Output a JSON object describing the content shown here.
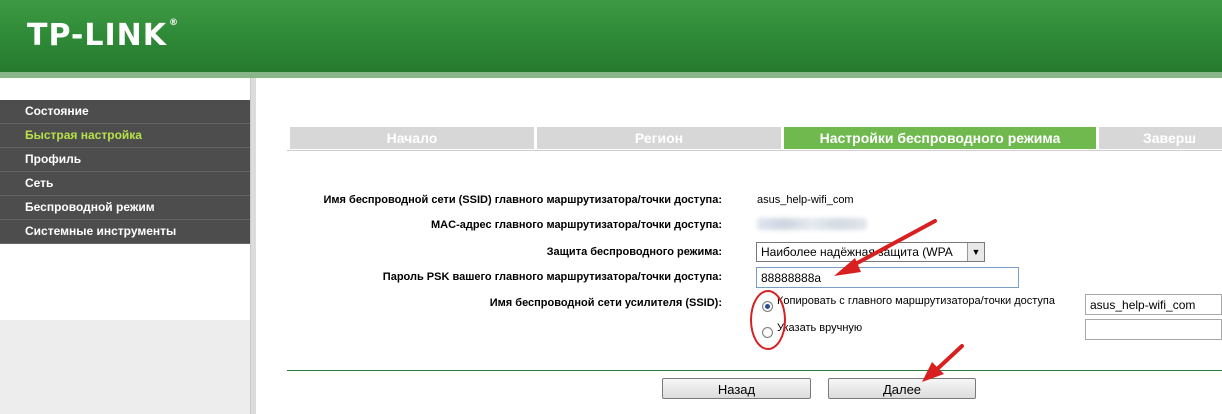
{
  "header": {
    "logo": "TP-LINK",
    "logo_mark": "®"
  },
  "sidebar": {
    "items": [
      {
        "label": "Состояние",
        "active": false
      },
      {
        "label": "Быстрая настройка",
        "active": true
      },
      {
        "label": "Профиль",
        "active": false
      },
      {
        "label": "Сеть",
        "active": false
      },
      {
        "label": "Беспроводной режим",
        "active": false
      },
      {
        "label": "Системные инструменты",
        "active": false
      }
    ]
  },
  "steps": [
    {
      "label": "Начало",
      "active": false
    },
    {
      "label": "Регион",
      "active": false
    },
    {
      "label": "Настройки беспроводного режима",
      "active": true
    },
    {
      "label": "Заверш",
      "active": false
    }
  ],
  "form": {
    "ssid_label": "Имя беспроводной сети (SSID) главного маршрутизатора/точки доступа:",
    "ssid_value": "asus_help-wifi_com",
    "mac_label": "MAC-адрес главного маршрутизатора/точки доступа:",
    "security_label": "Защита беспроводного режима:",
    "security_value": "Наиболее надёжная защита (WPA",
    "psk_label": "Пароль PSK вашего главного маршрутизатора/точки доступа:",
    "psk_value": "88888888a",
    "ext_ssid_label": "Имя беспроводной сети усилителя (SSID):",
    "radio_copy_label": "Копировать с главного маршрутизатора/точки доступа",
    "radio_copy_value": "asus_help-wifi_com",
    "radio_manual_label": "Указать вручную",
    "radio_manual_value": ""
  },
  "buttons": {
    "back": "Назад",
    "next": "Далее"
  },
  "colors": {
    "header_green": "#2f8a37",
    "active_step": "#6fb94e",
    "active_menu": "#b8e04a",
    "annotation": "#d92020"
  }
}
